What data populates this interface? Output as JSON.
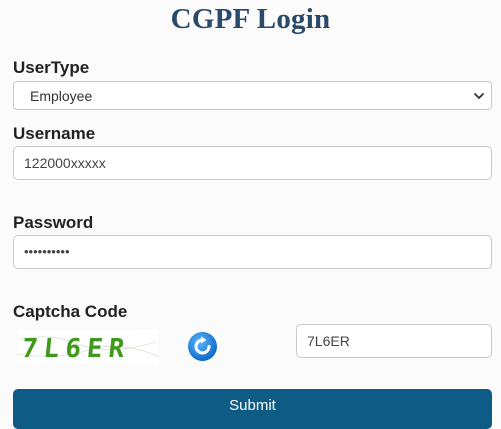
{
  "page": {
    "title": "CGPF Login"
  },
  "form": {
    "usertype_label": "UserType",
    "usertype_value": "Employee",
    "username_label": "Username",
    "username_value": "122000xxxxx",
    "password_label": "Password",
    "password_masked": "••••••••••",
    "captcha_label": "Captcha Code",
    "captcha_text": "7L6ER",
    "captcha_input_value": "7L6ER",
    "submit_label": "Submit"
  },
  "colors": {
    "title": "#2b4a6b",
    "submit_bg": "#0e5b86",
    "refresh_icon": "#1c7fd6",
    "captcha_text": "#3f9a1c"
  },
  "icons": {
    "refresh": "refresh-icon",
    "dropdown": "chevron-down-icon"
  }
}
